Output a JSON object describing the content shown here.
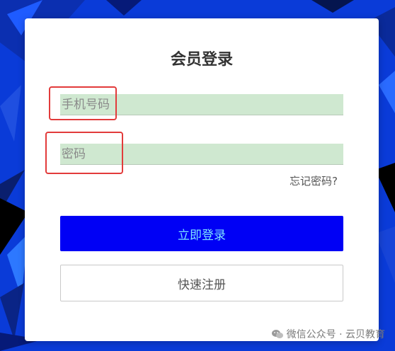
{
  "login": {
    "title": "会员登录",
    "phone_placeholder": "手机号码",
    "password_placeholder": "密码",
    "forgot_label": "忘记密码?",
    "login_label": "立即登录",
    "register_label": "快速注册"
  },
  "watermark": {
    "text": "微信公众号 · 云贝教育",
    "icon": "wechat-icon"
  },
  "colors": {
    "background": "#0a3bd8",
    "field_fill": "#cfe8d0",
    "primary_button": "#0000f5",
    "highlight_box": "#e23b3b"
  }
}
